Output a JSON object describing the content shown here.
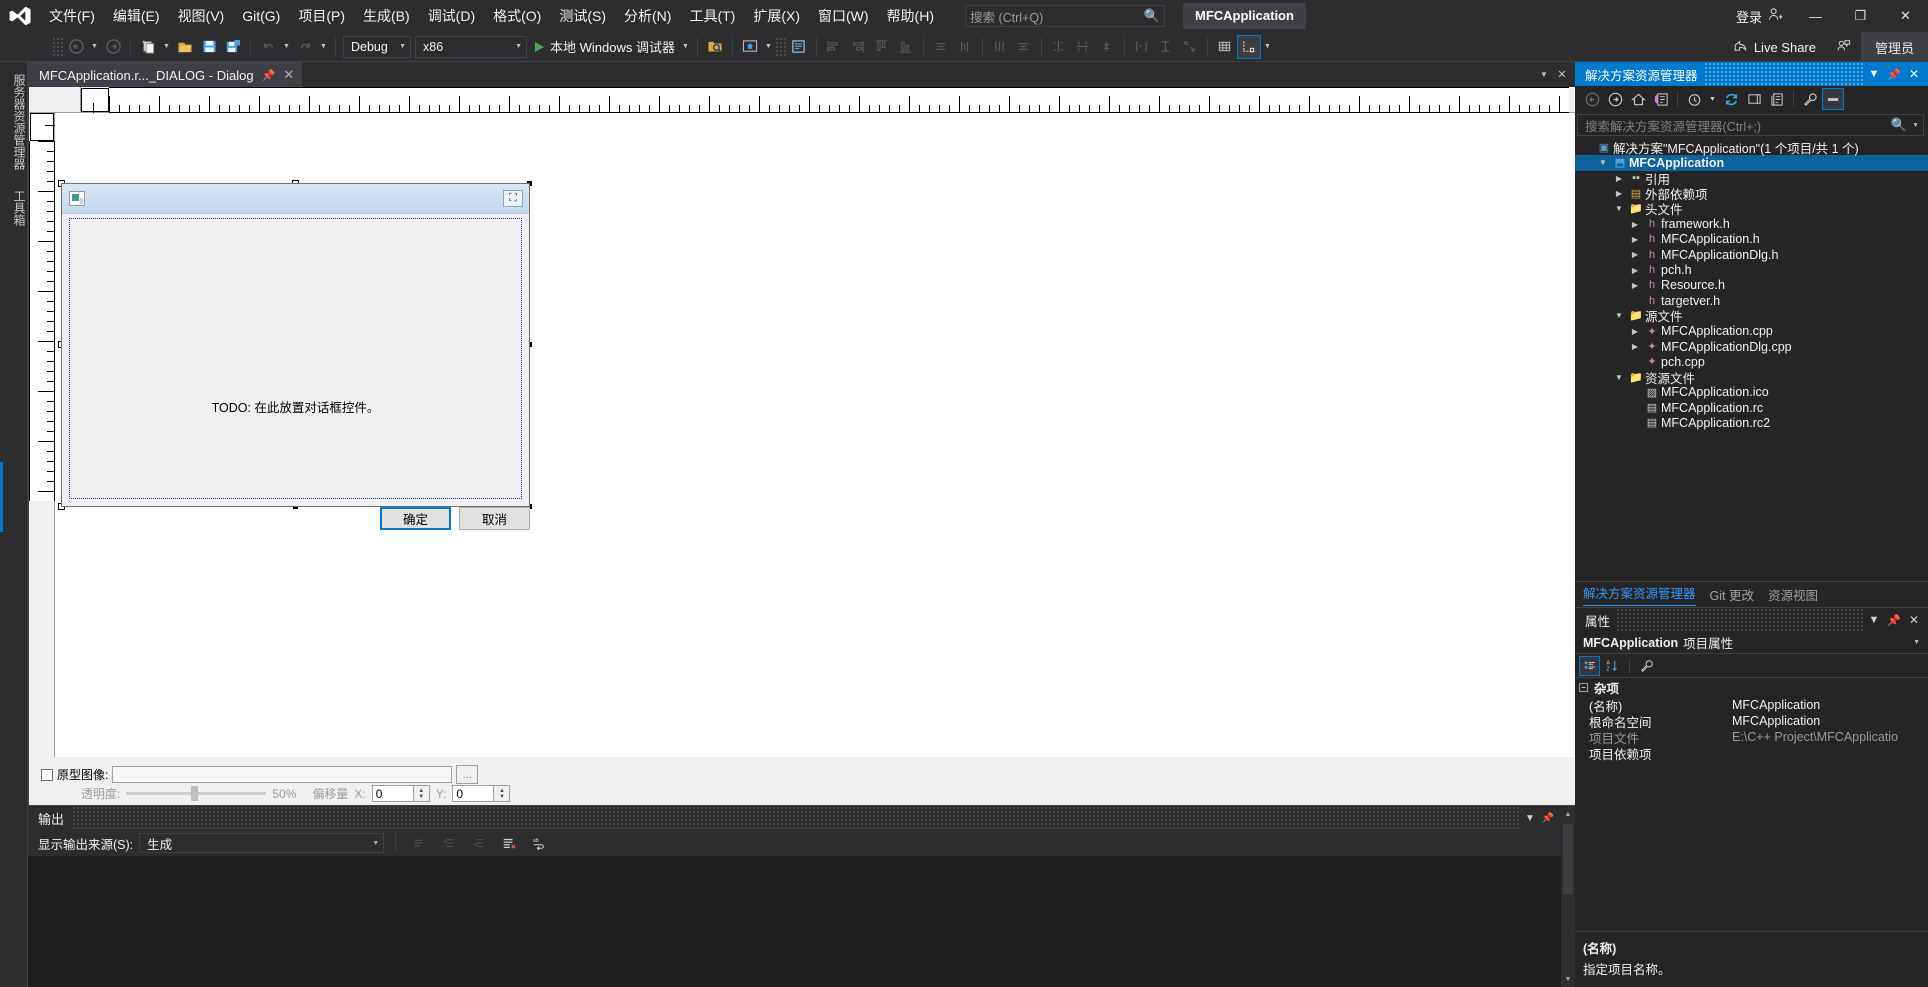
{
  "menu": {
    "items": [
      {
        "label": "文件(F)"
      },
      {
        "label": "编辑(E)"
      },
      {
        "label": "视图(V)"
      },
      {
        "label": "Git(G)"
      },
      {
        "label": "项目(P)"
      },
      {
        "label": "生成(B)"
      },
      {
        "label": "调试(D)"
      },
      {
        "label": "格式(O)"
      },
      {
        "label": "测试(S)"
      },
      {
        "label": "分析(N)"
      },
      {
        "label": "工具(T)"
      },
      {
        "label": "扩展(X)"
      },
      {
        "label": "窗口(W)"
      },
      {
        "label": "帮助(H)"
      }
    ],
    "search_placeholder": "搜索 (Ctrl+Q)",
    "project_chip": "MFCApplication",
    "sign_in": "登录"
  },
  "toolbar": {
    "config": "Debug",
    "platform": "x86",
    "run_label": "本地 Windows 调试器",
    "live_share": "Live Share",
    "admin": "管理员"
  },
  "leftrail": {
    "tabs": [
      "服务器资源管理器",
      "工具箱"
    ]
  },
  "document": {
    "tab_label": "MFCApplication.r..._DIALOG - Dialog"
  },
  "dialog": {
    "todo_text": "TODO: 在此放置对话框控件。",
    "ok_label": "确定",
    "cancel_label": "取消"
  },
  "prototype": {
    "checkbox_label": "原型图像:",
    "path_value": "",
    "browse_label": "...",
    "opacity_label": "透明度:",
    "opacity_value": "50%",
    "offset_label": "偏移量",
    "offset_x_label": "X:",
    "offset_x_value": "0",
    "offset_y_label": "Y:",
    "offset_y_value": "0"
  },
  "output": {
    "title": "输出",
    "source_label": "显示输出来源(S):",
    "source_value": "生成",
    "body_text": ""
  },
  "solution_explorer": {
    "title": "解决方案资源管理器",
    "search_placeholder": "搜索解决方案资源管理器(Ctrl+;)",
    "tree": [
      {
        "label": "解决方案\"MFCApplication\"(1 个项目/共 1 个)",
        "indent": 0,
        "expander": "",
        "icon": "solution-icon",
        "icon_glyph": "▣",
        "icon_color": "#5a9fd4",
        "selected": false,
        "bold": false
      },
      {
        "label": "MFCApplication",
        "indent": 1,
        "expander": "▲",
        "icon": "project-icon",
        "icon_glyph": "⬒",
        "icon_color": "#5a9fd4",
        "selected": true,
        "bold": true
      },
      {
        "label": "引用",
        "indent": 2,
        "expander": "▶",
        "icon": "references-icon",
        "icon_glyph": "▪▪",
        "icon_color": "#c8c8c8",
        "selected": false,
        "bold": false
      },
      {
        "label": "外部依赖项",
        "indent": 2,
        "expander": "▶",
        "icon": "external-deps-icon",
        "icon_glyph": "▤",
        "icon_color": "#d3a04a",
        "selected": false,
        "bold": false
      },
      {
        "label": "头文件",
        "indent": 2,
        "expander": "▲",
        "icon": "folder-icon",
        "icon_glyph": "📁",
        "icon_color": "#d3a04a",
        "selected": false,
        "bold": false
      },
      {
        "label": "framework.h",
        "indent": 3,
        "expander": "▶",
        "icon": "h-file-icon",
        "icon_glyph": "h",
        "icon_color": "#c586c0",
        "selected": false,
        "bold": false
      },
      {
        "label": "MFCApplication.h",
        "indent": 3,
        "expander": "▶",
        "icon": "h-file-icon",
        "icon_glyph": "h",
        "icon_color": "#c586c0",
        "selected": false,
        "bold": false
      },
      {
        "label": "MFCApplicationDlg.h",
        "indent": 3,
        "expander": "▶",
        "icon": "h-file-icon",
        "icon_glyph": "h",
        "icon_color": "#c586c0",
        "selected": false,
        "bold": false
      },
      {
        "label": "pch.h",
        "indent": 3,
        "expander": "▶",
        "icon": "h-file-icon",
        "icon_glyph": "h",
        "icon_color": "#c586c0",
        "selected": false,
        "bold": false
      },
      {
        "label": "Resource.h",
        "indent": 3,
        "expander": "▶",
        "icon": "h-file-icon",
        "icon_glyph": "h",
        "icon_color": "#c586c0",
        "selected": false,
        "bold": false
      },
      {
        "label": "targetver.h",
        "indent": 3,
        "expander": "",
        "icon": "h-file-icon",
        "icon_glyph": "h",
        "icon_color": "#c586c0",
        "selected": false,
        "bold": false
      },
      {
        "label": "源文件",
        "indent": 2,
        "expander": "▲",
        "icon": "folder-icon",
        "icon_glyph": "📁",
        "icon_color": "#d3a04a",
        "selected": false,
        "bold": false
      },
      {
        "label": "MFCApplication.cpp",
        "indent": 3,
        "expander": "▶",
        "icon": "cpp-file-icon",
        "icon_glyph": "✦",
        "icon_color": "#c586c0",
        "selected": false,
        "bold": false
      },
      {
        "label": "MFCApplicationDlg.cpp",
        "indent": 3,
        "expander": "▶",
        "icon": "cpp-file-icon",
        "icon_glyph": "✦",
        "icon_color": "#c586c0",
        "selected": false,
        "bold": false
      },
      {
        "label": "pch.cpp",
        "indent": 3,
        "expander": "",
        "icon": "cpp-file-icon",
        "icon_glyph": "✦",
        "icon_color": "#c586c0",
        "selected": false,
        "bold": false
      },
      {
        "label": "资源文件",
        "indent": 2,
        "expander": "▲",
        "icon": "folder-icon",
        "icon_glyph": "📁",
        "icon_color": "#d3a04a",
        "selected": false,
        "bold": false
      },
      {
        "label": "MFCApplication.ico",
        "indent": 3,
        "expander": "",
        "icon": "image-file-icon",
        "icon_glyph": "▨",
        "icon_color": "#c5c5c5",
        "selected": false,
        "bold": false
      },
      {
        "label": "MFCApplication.rc",
        "indent": 3,
        "expander": "",
        "icon": "rc-file-icon",
        "icon_glyph": "▤",
        "icon_color": "#c5c5c5",
        "selected": false,
        "bold": false
      },
      {
        "label": "MFCApplication.rc2",
        "indent": 3,
        "expander": "",
        "icon": "rc-file-icon",
        "icon_glyph": "▤",
        "icon_color": "#c5c5c5",
        "selected": false,
        "bold": false
      }
    ],
    "tabs": [
      {
        "label": "解决方案资源管理器",
        "active": true
      },
      {
        "label": "Git 更改",
        "active": false
      },
      {
        "label": "资源视图",
        "active": false
      }
    ]
  },
  "properties": {
    "title": "属性",
    "object_name": "MFCApplication",
    "object_suffix": "项目属性",
    "category": "杂项",
    "rows": [
      {
        "key": "(名称)",
        "value": "MFCApplication",
        "dim": false
      },
      {
        "key": "根命名空间",
        "value": "MFCApplication",
        "dim": false
      },
      {
        "key": "项目文件",
        "value": "E:\\C++ Project\\MFCApplicatio",
        "dim": true
      },
      {
        "key": "项目依赖项",
        "value": "",
        "dim": false
      }
    ],
    "desc_title": "(名称)",
    "desc_text": "指定项目名称。"
  },
  "colors": {
    "accent": "#007acc",
    "selection": "#0e639c",
    "chrome": "#2d2d30",
    "panel": "#252526",
    "editor": "#1e1e1e"
  }
}
